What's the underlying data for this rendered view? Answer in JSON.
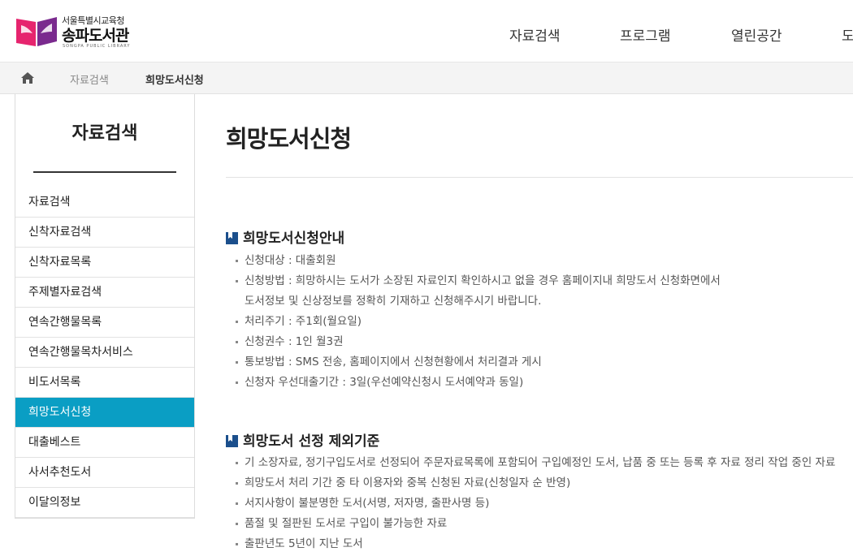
{
  "header": {
    "logo_sub": "서울특별시교육청",
    "logo_main": "송파도서관",
    "logo_eng": "SONGPA PUBLIC LIBRARY",
    "nav": [
      "자료검색",
      "프로그램",
      "열린공간",
      "도"
    ]
  },
  "breadcrumb": {
    "home_icon": "home-icon",
    "items": [
      "자료검색",
      "희망도서신청"
    ]
  },
  "sidebar": {
    "title": "자료검색",
    "items": [
      {
        "label": "자료검색"
      },
      {
        "label": "신착자료검색"
      },
      {
        "label": "신착자료목록"
      },
      {
        "label": "주제별자료검색"
      },
      {
        "label": "연속간행물목록"
      },
      {
        "label": "연속간행물목차서비스"
      },
      {
        "label": "비도서목록"
      },
      {
        "label": "희망도서신청"
      },
      {
        "label": "대출베스트"
      },
      {
        "label": "사서추천도서"
      },
      {
        "label": "이달의정보"
      }
    ],
    "active_index": 7
  },
  "main": {
    "title": "희망도서신청",
    "section1": {
      "title": "희망도서신청안내",
      "items": [
        "신청대상 : 대출회원",
        "신청방법 : 희망하시는 도서가 소장된 자료인지 확인하시고 없을 경우 홈페이지내 희망도서 신청화면에서",
        "도서정보 및 신상정보를 정확히 기재하고 신청해주시기 바랍니다.",
        "처리주기 : 주1회(월요일)",
        "신청권수 : 1인 월3권",
        "통보방법 : SMS 전송, 홈페이지에서 신청현황에서 처리결과 게시",
        "신청자 우선대출기간 : 3일(우선예약신청시 도서예약과 동일)"
      ]
    },
    "section2": {
      "title": "희망도서 선정 제외기준",
      "items": [
        "기 소장자료, 정기구입도서로 선정되어 주문자료목록에 포함되어 구입예정인 도서, 납품 중 또는 등록 후 자료 정리 작업 중인 자료",
        "희망도서 처리 기간 중 타 이용자와 중복 신청된 자료(신청일자 순 반영)",
        "서지사항이 불분명한 도서(서명, 저자명, 출판사명 등)",
        "품절 및 절판된 도서로 구입이 불가능한 자료",
        "출판년도 5년이 지난 도서"
      ]
    }
  },
  "colors": {
    "accent": "#0a9ec4",
    "section_icon": "#1b4f8c",
    "logo_pink": "#e6246e",
    "logo_purple": "#7a2a8e"
  }
}
